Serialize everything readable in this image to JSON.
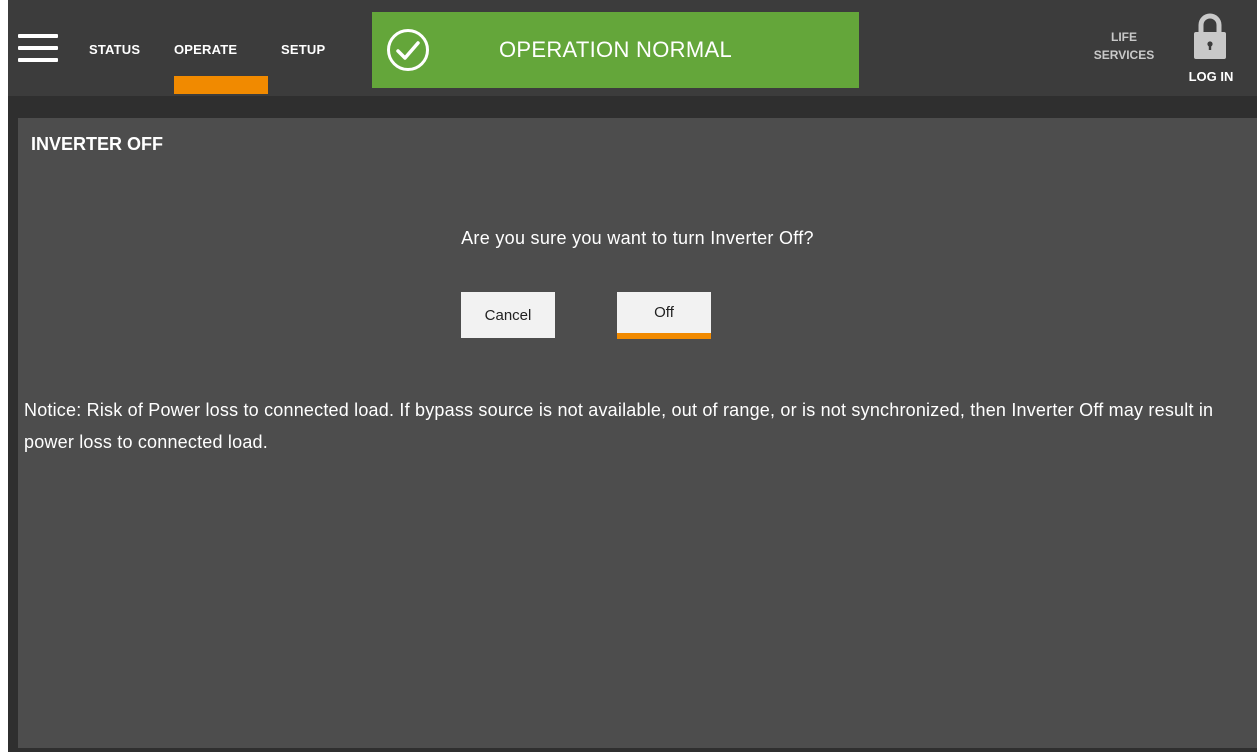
{
  "header": {
    "tabs": [
      {
        "label": "STATUS",
        "active": false
      },
      {
        "label": "OPERATE",
        "active": true
      },
      {
        "label": "SETUP",
        "active": false
      }
    ],
    "status_banner": {
      "text": "OPERATION NORMAL",
      "icon": "check-circle-icon",
      "color": "#64a63a"
    },
    "life_services": {
      "line1": "LIFE",
      "line2": "SERVICES"
    },
    "login": {
      "label": "LOG IN",
      "icon": "lock-icon"
    }
  },
  "panel": {
    "title": "INVERTER OFF",
    "question": "Are you sure you want to turn Inverter Off?",
    "cancel_label": "Cancel",
    "off_label": "Off",
    "notice": "Notice: Risk of Power loss to connected load. If bypass source is not available, out of range, or is not synchronized, then Inverter Off may result in power loss to connected load."
  },
  "colors": {
    "accent": "#f18a00",
    "panel_bg": "#4d4d4d",
    "header_bg": "#3c3c3c"
  }
}
